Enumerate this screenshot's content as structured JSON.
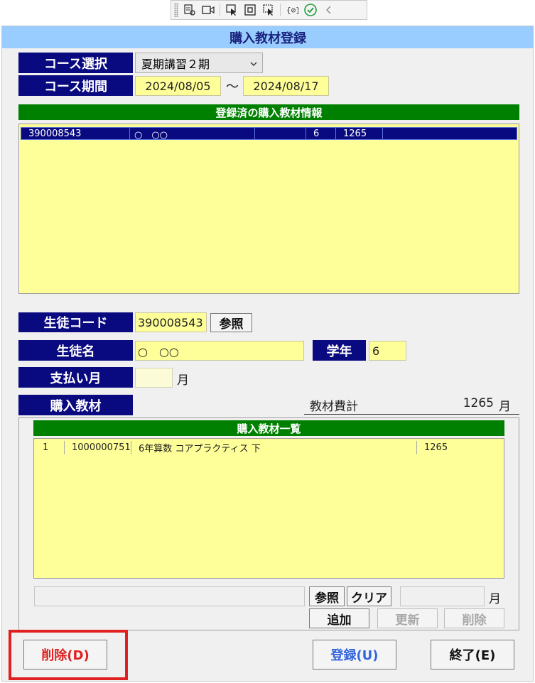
{
  "toolbar": {
    "icons": [
      "live-visual-tree-icon",
      "camera-icon",
      "select-element-icon",
      "track-focus-icon",
      "display-adorners-icon",
      "hot-reload-icon",
      "checkmark-icon",
      "collapse-icon"
    ]
  },
  "window": {
    "title": "購入教材登録"
  },
  "course": {
    "select_label": "コース選択",
    "selected": "夏期講習２期",
    "period_label": "コース期間",
    "start": "2024/08/05",
    "separator": "～",
    "end": "2024/08/17"
  },
  "registered": {
    "header": "登録済の購入教材情報",
    "rows": [
      {
        "code": "390008543",
        "name": "○　○○",
        "c3": "",
        "grade": "6",
        "amount": "1265",
        "c6": ""
      }
    ]
  },
  "student": {
    "code_label": "生徒コード",
    "code": "390008543",
    "ref_button": "参照",
    "name_label": "生徒名",
    "name": "○　○○",
    "grade_label": "学年",
    "grade": "6",
    "pay_label": "支払い月",
    "pay_value": "",
    "month_unit": "月"
  },
  "materials": {
    "label": "購入教材",
    "total_label": "教材費計",
    "total_value": "1265",
    "total_unit": "月",
    "list_header": "購入教材一覧",
    "rows": [
      {
        "no": "1",
        "code": "1000000751",
        "name": "6年算数 コアプラクティス 下",
        "price": "1265"
      }
    ],
    "input_value": "",
    "ref_button": "参照",
    "clear_button": "クリア",
    "price_value": "",
    "price_unit": "月",
    "add_button": "追加",
    "update_button": "更新",
    "delete_button": "削除"
  },
  "footer": {
    "delete_button": "削除(D)",
    "register_button": "登録(U)",
    "exit_button": "終了(E)"
  },
  "colors": {
    "label_bg": "#0a0a80",
    "title_bg": "#99ccff",
    "field_bg": "#ffff99",
    "header_green": "#008000",
    "highlight_red": "#e02020",
    "delete_text": "#e02020",
    "register_text": "#3366dd"
  }
}
